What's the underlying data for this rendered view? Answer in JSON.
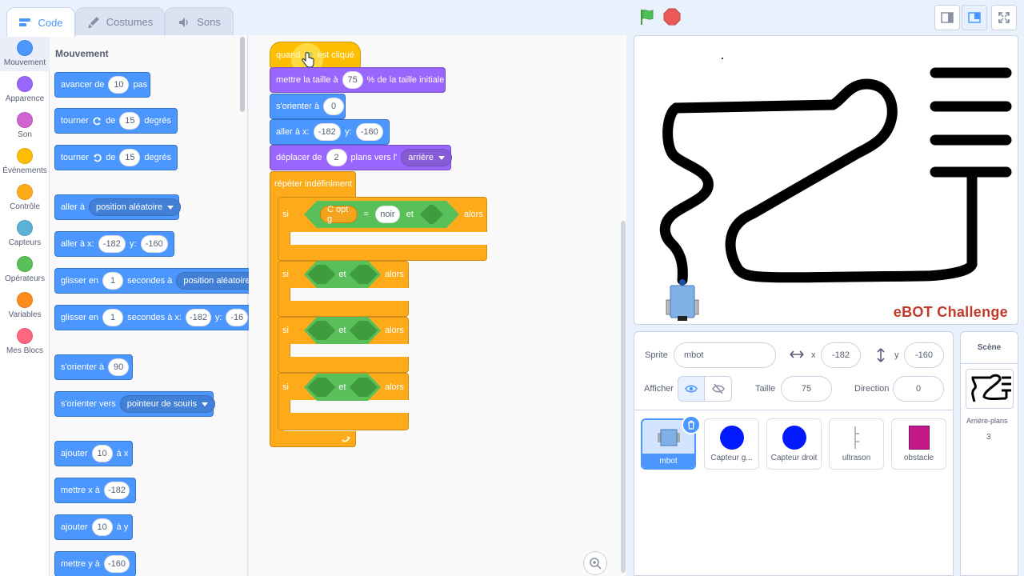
{
  "tabs": [
    {
      "label": "Code",
      "icon": "code-icon"
    },
    {
      "label": "Costumes",
      "icon": "brush-icon"
    },
    {
      "label": "Sons",
      "icon": "speaker-icon"
    }
  ],
  "categories": [
    {
      "label": "Mouvement",
      "color": "#4c97ff"
    },
    {
      "label": "Apparence",
      "color": "#9966ff"
    },
    {
      "label": "Son",
      "color": "#cf63cf"
    },
    {
      "label": "Événements",
      "color": "#ffbf00"
    },
    {
      "label": "Contrôle",
      "color": "#ffab19"
    },
    {
      "label": "Capteurs",
      "color": "#5cb1d6"
    },
    {
      "label": "Opérateurs",
      "color": "#59c059"
    },
    {
      "label": "Variables",
      "color": "#ff8c1a"
    },
    {
      "label": "Mes Blocs",
      "color": "#ff6680"
    }
  ],
  "palette": {
    "title": "Mouvement",
    "move": {
      "a": "avancer de",
      "v": "10",
      "b": "pas"
    },
    "turn_right": {
      "a": "tourner",
      "b": "de",
      "v": "15",
      "c": "degrés"
    },
    "turn_left": {
      "a": "tourner",
      "b": "de",
      "v": "15",
      "c": "degrés"
    },
    "goto_random": {
      "a": "aller à",
      "dd": "position aléatoire"
    },
    "goto_xy": {
      "a": "aller à x:",
      "x": "-182",
      "b": "y:",
      "y": "-160"
    },
    "glide_random": {
      "a": "glisser en",
      "v": "1",
      "b": "secondes à",
      "dd": "position aléatoire"
    },
    "glide_xy": {
      "a": "glisser en",
      "v": "1",
      "b": "secondes à x:",
      "x": "-182",
      "c": "y:",
      "y": "-16"
    },
    "point_dir": {
      "a": "s'orienter à",
      "v": "90"
    },
    "point_towards": {
      "a": "s'orienter vers",
      "dd": "pointeur de souris"
    },
    "change_x": {
      "a": "ajouter",
      "v": "10",
      "b": "à x"
    },
    "set_x": {
      "a": "mettre x à",
      "v": "-182"
    },
    "change_y": {
      "a": "ajouter",
      "v": "10",
      "b": "à y"
    },
    "set_y": {
      "a": "mettre y à",
      "v": "-160"
    }
  },
  "script": {
    "hat": {
      "a": "quand",
      "b": "est cliqué"
    },
    "size": {
      "a": "mettre la taille à",
      "v": "75",
      "b": "% de la taille initiale"
    },
    "point": {
      "a": "s'orienter à",
      "v": "0"
    },
    "goto": {
      "a": "aller à x:",
      "x": "-182",
      "b": "y:",
      "y": "-160"
    },
    "layer": {
      "a": "déplacer de",
      "v": "2",
      "b": "plans vers l'",
      "dd": "arrière"
    },
    "forever": "répéter indéfiniment",
    "if1": {
      "si": "si",
      "sensor": "C opt g",
      "eq": "=",
      "val": "noir",
      "et": "et",
      "alors": "alors"
    },
    "if2": {
      "si": "si",
      "et": "et",
      "alors": "alors"
    },
    "if3": {
      "si": "si",
      "et": "et",
      "alors": "alors"
    },
    "if4": {
      "si": "si",
      "et": "et",
      "alors": "alors"
    }
  },
  "stage": {
    "caption": "eBOT Challenge"
  },
  "sprite_info": {
    "sprite_label": "Sprite",
    "sprite_name": "mbot",
    "x_label": "x",
    "x": "-182",
    "y_label": "y",
    "y": "-160",
    "show_label": "Afficher",
    "size_label": "Taille",
    "size": "75",
    "direction_label": "Direction",
    "direction": "0"
  },
  "sprites": [
    {
      "name": "mbot",
      "selected": true
    },
    {
      "name": "Capteur g..."
    },
    {
      "name": "Capteur droit"
    },
    {
      "name": "ultrason"
    },
    {
      "name": "obstacle"
    }
  ],
  "stage_panel": {
    "title": "Scène",
    "backdrops_label": "Arrière-plans",
    "backdrops_count": "3"
  }
}
